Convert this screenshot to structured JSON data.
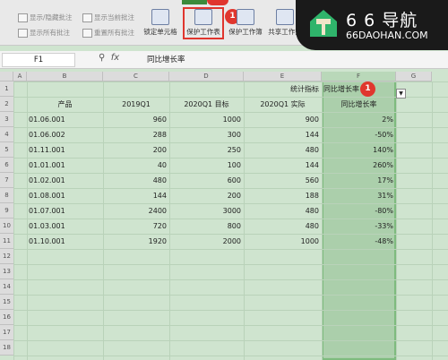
{
  "ribbon": {
    "left_items": [
      "显示/隐藏批注",
      "显示所有批注",
      "显示当前批注",
      "重置所有批注"
    ],
    "buttons": [
      "锁定单元格",
      "保护工作表",
      "保护工作簿",
      "共享工作簿"
    ],
    "badge": "1"
  },
  "watermark": {
    "title": "6 6 导航",
    "subtitle": "66DAOHAN.COM"
  },
  "formula_bar": {
    "cell_ref": "F1",
    "fx": "fx",
    "content": "同比增长率"
  },
  "columns": [
    "A",
    "B",
    "C",
    "D",
    "E",
    "F",
    "G"
  ],
  "rows": [
    "1",
    "2",
    "3",
    "4",
    "5",
    "6",
    "7",
    "8",
    "9",
    "10",
    "11",
    "12",
    "13",
    "14",
    "15",
    "16",
    "17",
    "18"
  ],
  "table": {
    "e1_label": "统计指标",
    "f1_value": "同比增长率",
    "headers": {
      "b": "产品",
      "c": "2019Q1",
      "d": "2020Q1 目标",
      "e": "2020Q1 实际",
      "f": "同比增长率"
    },
    "data": [
      {
        "b": "01.06.001",
        "c": "960",
        "d": "1000",
        "e": "900",
        "f": "2%"
      },
      {
        "b": "01.06.002",
        "c": "288",
        "d": "300",
        "e": "144",
        "f": "-50%"
      },
      {
        "b": "01.11.001",
        "c": "200",
        "d": "250",
        "e": "480",
        "f": "140%"
      },
      {
        "b": "01.01.001",
        "c": "40",
        "d": "100",
        "e": "144",
        "f": "260%"
      },
      {
        "b": "01.02.001",
        "c": "480",
        "d": "600",
        "e": "560",
        "f": "17%"
      },
      {
        "b": "01.08.001",
        "c": "144",
        "d": "200",
        "e": "188",
        "f": "31%"
      },
      {
        "b": "01.07.001",
        "c": "2400",
        "d": "3000",
        "e": "480",
        "f": "-80%"
      },
      {
        "b": "01.03.001",
        "c": "720",
        "d": "800",
        "e": "480",
        "f": "-33%"
      },
      {
        "b": "01.10.001",
        "c": "1920",
        "d": "2000",
        "e": "1000",
        "f": "-48%"
      }
    ]
  }
}
